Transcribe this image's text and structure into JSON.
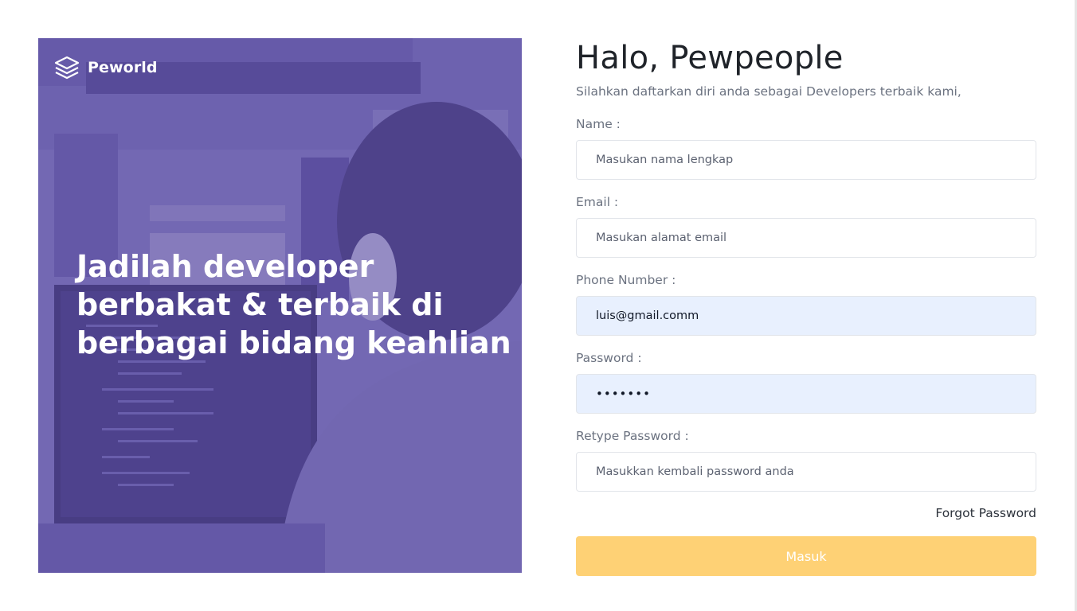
{
  "brand": {
    "name": "Peworld",
    "icon": "layers-icon"
  },
  "hero": {
    "headline": "Jadilah developer berbakat & terbaik di berbagai bidang keahlian",
    "overlay_color": "#5e50a1"
  },
  "form": {
    "title": "Halo, Pewpeople",
    "subtitle": "Silahkan daftarkan diri anda sebagai Developers terbaik kami,",
    "fields": {
      "name": {
        "label": "Name :",
        "placeholder": "Masukan nama lengkap",
        "value": ""
      },
      "email": {
        "label": "Email :",
        "placeholder": "Masukan alamat email",
        "value": ""
      },
      "phone": {
        "label": "Phone Number :",
        "placeholder": "",
        "value": "luis@gmail.comm"
      },
      "password": {
        "label": "Password :",
        "placeholder": "",
        "value": "•••••••"
      },
      "retype_password": {
        "label": "Retype Password :",
        "placeholder": "Masukkan kembali password anda",
        "value": ""
      }
    },
    "forgot_password": "Forgot Password",
    "submit_label": "Masuk",
    "colors": {
      "submit_bg": "#fed175",
      "autofill_bg": "#e8f0fe"
    }
  }
}
